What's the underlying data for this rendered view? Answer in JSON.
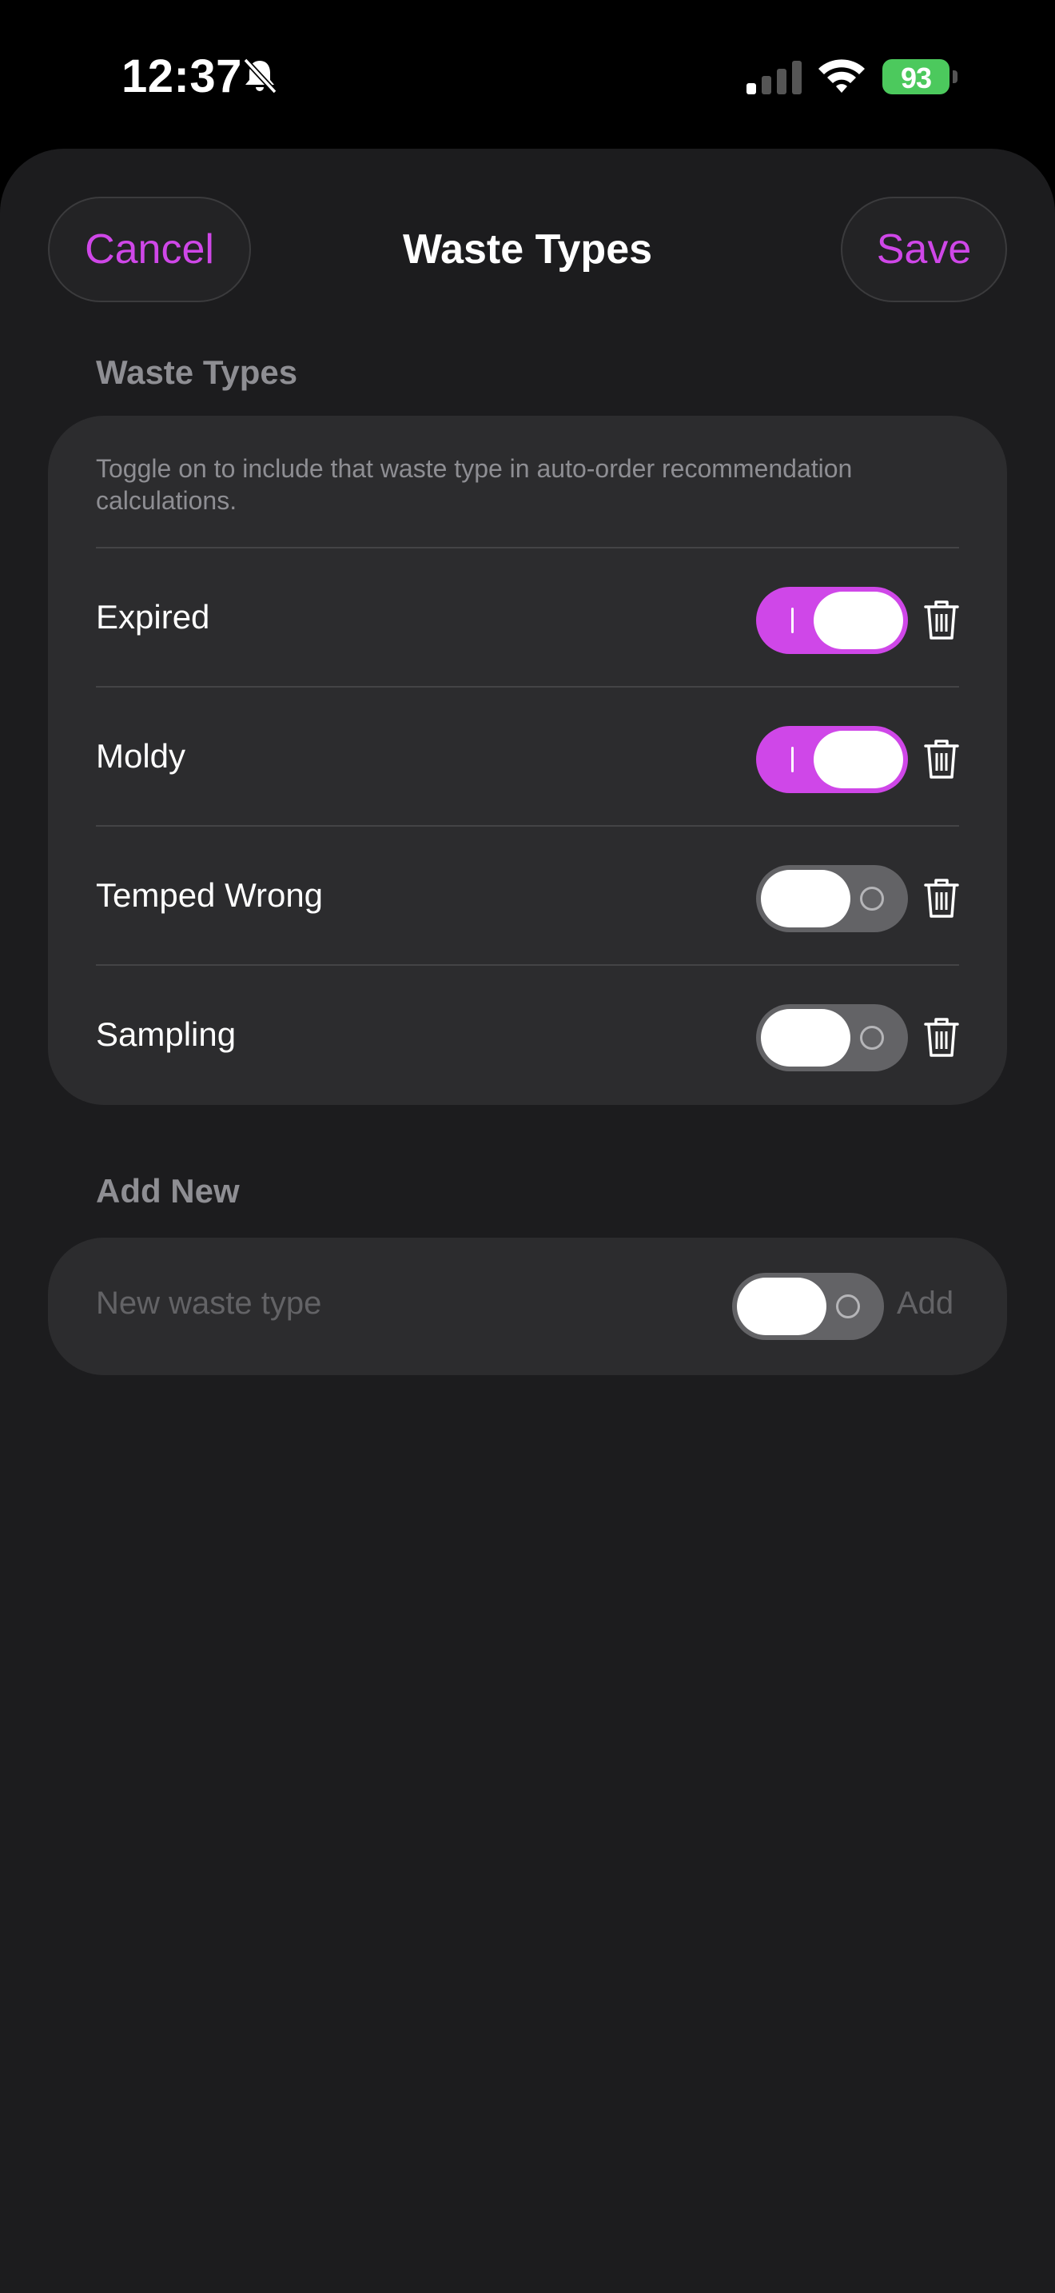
{
  "status_bar": {
    "time": "12:37",
    "battery": "93"
  },
  "nav": {
    "cancel_label": "Cancel",
    "title": "Waste Types",
    "save_label": "Save"
  },
  "waste_section": {
    "header": "Waste Types",
    "description": "Toggle on to include that waste type in auto-order recommendation calculations.",
    "items": [
      {
        "label": "Expired",
        "enabled": true
      },
      {
        "label": "Moldy",
        "enabled": true
      },
      {
        "label": "Temped Wrong",
        "enabled": false
      },
      {
        "label": "Sampling",
        "enabled": false
      }
    ]
  },
  "add_section": {
    "header": "Add New",
    "input_placeholder": "New waste type",
    "toggle_enabled": false,
    "add_label": "Add"
  },
  "colors": {
    "accent": "#cf47e8",
    "background": "#1c1c1e",
    "card": "#2c2c2e",
    "battery": "#4cc95d"
  },
  "icons": [
    "bell-slash-icon",
    "cellular-signal-icon",
    "wifi-icon",
    "battery-icon",
    "trash-icon"
  ]
}
